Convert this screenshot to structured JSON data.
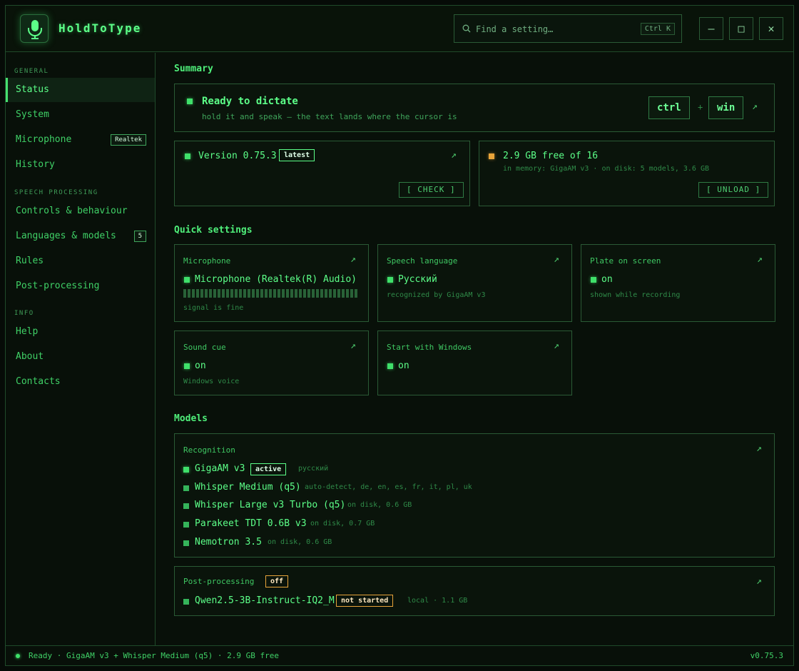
{
  "app": {
    "title": "HoldToType"
  },
  "search": {
    "placeholder": "Find a setting…",
    "shortcut": "Ctrl K"
  },
  "window_controls": {
    "minimize": "–",
    "maximize": "□",
    "close": "✕"
  },
  "sidebar": {
    "sections": [
      {
        "label": "GENERAL"
      },
      {
        "label": "SPEECH PROCESSING"
      },
      {
        "label": "INFO"
      }
    ],
    "items": [
      {
        "label": "Status",
        "active": true
      },
      {
        "label": "System"
      },
      {
        "label": "Microphone",
        "badge": "Realtek"
      },
      {
        "label": "History"
      },
      {
        "label": "Controls & behaviour"
      },
      {
        "label": "Languages & models",
        "badge": "5"
      },
      {
        "label": "Rules"
      },
      {
        "label": "Post-processing"
      },
      {
        "label": "Help"
      },
      {
        "label": "About"
      },
      {
        "label": "Contacts"
      }
    ]
  },
  "summary": {
    "title": "Summary",
    "ready": {
      "title": "Ready to dictate",
      "subtitle": "hold it and speak — the text lands where the cursor is",
      "keys": [
        "ctrl",
        "win"
      ],
      "plus": "+"
    },
    "version": {
      "label": "Version 0.75.3",
      "tag": "latest",
      "button": "[ CHECK ]"
    },
    "memory": {
      "label": "2.9 GB free of 16",
      "detail": "in memory: GigaAM v3 · on disk: 5 models, 3.6 GB",
      "button": "[ UNLOAD ]"
    }
  },
  "quick": {
    "title": "Quick settings",
    "cards": [
      {
        "label": "Microphone",
        "value": "Microphone (Realtek(R) Audio)",
        "sub": "signal is fine"
      },
      {
        "label": "Speech language",
        "value": "Русский",
        "sub": "recognized by GigaAM v3"
      },
      {
        "label": "Plate on screen",
        "value": "on",
        "sub": "shown while recording"
      },
      {
        "label": "Sound cue",
        "value": "on",
        "sub": "Windows voice"
      },
      {
        "label": "Start with Windows",
        "value": "on"
      }
    ]
  },
  "models": {
    "title": "Models",
    "recognition": {
      "label": "Recognition",
      "items": [
        {
          "name": "GigaAM v3",
          "tag": "active",
          "extra": "русский"
        },
        {
          "name": "Whisper Medium (q5)",
          "extra": "auto-detect, de, en, es, fr, it, pl, uk"
        },
        {
          "name": "Whisper Large v3 Turbo (q5)",
          "extra": "on disk, 0.6 GB"
        },
        {
          "name": "Parakeet TDT 0.6B v3",
          "extra": "on disk, 0.7 GB"
        },
        {
          "name": "Nemotron 3.5",
          "extra": "on disk, 0.6 GB"
        }
      ]
    },
    "postprocessing": {
      "label": "Post-processing",
      "tag": "off",
      "item": {
        "name": "Qwen2.5-3B-Instruct-IQ2_M",
        "tag": "not started",
        "extra": "local · 1.1 GB"
      }
    }
  },
  "statusbar": {
    "text": "Ready · GigaAM v3 + Whisper Medium (q5) · 2.9 GB free",
    "version": "v0.75.3"
  },
  "arrow": "↗",
  "colors": {
    "accent": "#3fe06a",
    "warning": "#e8a43a",
    "background": "#060b07"
  }
}
